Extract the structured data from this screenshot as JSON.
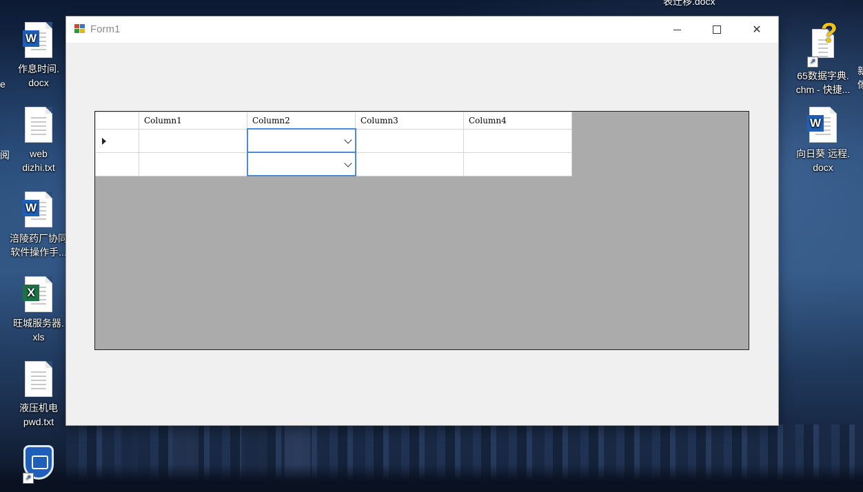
{
  "desktop": {
    "icons": [
      {
        "name": "作息时间.docx",
        "line1": "作息时间.",
        "line2": "docx",
        "kind": "word"
      },
      {
        "name": "web dizhi.txt",
        "line1": "web",
        "line2": "dizhi.txt",
        "kind": "text"
      },
      {
        "name": "涪陵药厂协同软件操作手...",
        "line1": "涪陵药厂协同",
        "line2": "软件操作手...",
        "kind": "word"
      },
      {
        "name": "旺城服务器.xls",
        "line1": "旺城服务器.",
        "line2": "xls",
        "kind": "excel"
      },
      {
        "name": "液压机电pwd.txt",
        "line1": "液压机电",
        "line2": "pwd.txt",
        "kind": "text"
      },
      {
        "name": "65数据字典.chm - 快捷...",
        "line1": "65数据字典.",
        "line2": "chm - 快捷...",
        "kind": "help-shortcut"
      },
      {
        "name": "向日葵 远程.docx",
        "line1": "向日葵 远程.",
        "line2": "docx",
        "kind": "word"
      }
    ],
    "clipped": {
      "top_right": "表迁移.docx",
      "left_1": "e",
      "left_2": "阅",
      "right_1": "新",
      "right_2": "傢"
    }
  },
  "window": {
    "title": "Form1",
    "controls": {
      "minimize": "minimize",
      "maximize": "maximize",
      "close": "close"
    }
  },
  "grid": {
    "columns": [
      "Column1",
      "Column2",
      "Column3",
      "Column4"
    ],
    "rows": [
      {
        "current": true,
        "cells": [
          "",
          "",
          "",
          ""
        ]
      },
      {
        "current": false,
        "cells": [
          "",
          "",
          "",
          ""
        ]
      }
    ],
    "combo_column": "Column2"
  }
}
